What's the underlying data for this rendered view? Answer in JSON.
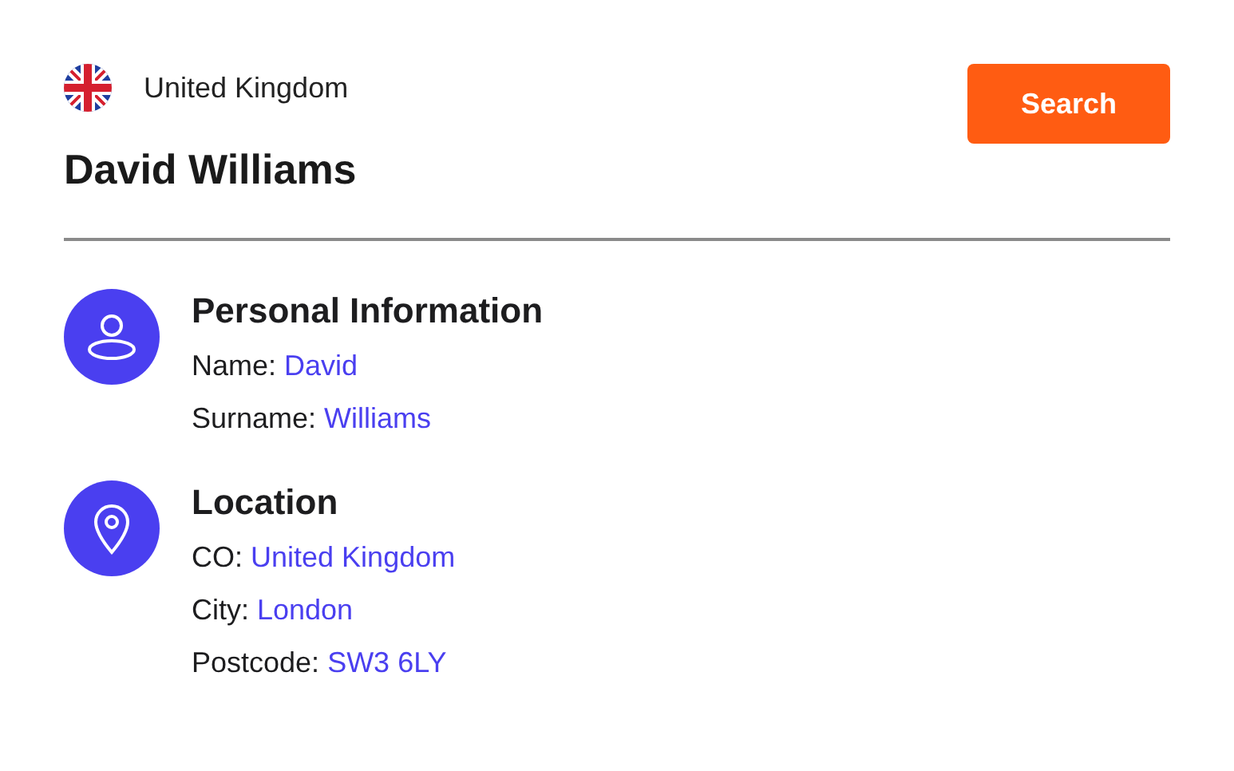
{
  "header": {
    "country": "United Kingdom",
    "name": "David Williams",
    "search_button": "Search"
  },
  "sections": [
    {
      "kind": "person",
      "title": "Personal Information",
      "fields": [
        {
          "label": "Name:",
          "value": "David"
        },
        {
          "label": "Surname:",
          "value": "Williams"
        }
      ]
    },
    {
      "kind": "location",
      "title": "Location",
      "fields": [
        {
          "label": "CO:",
          "value": "United Kingdom"
        },
        {
          "label": "City:",
          "value": "London"
        },
        {
          "label": "Postcode:",
          "value": "SW3 6LY"
        }
      ]
    }
  ]
}
